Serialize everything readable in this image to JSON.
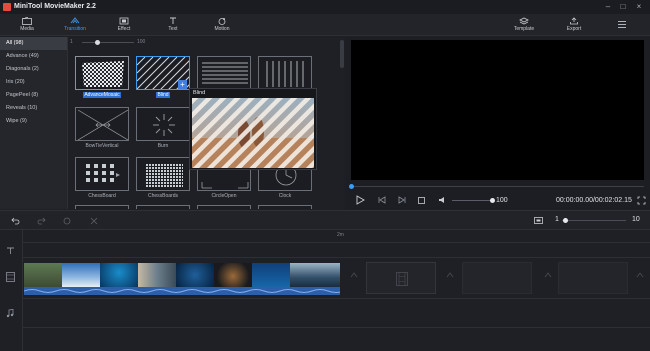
{
  "app": {
    "title": "MiniTool MovieMaker 2.2"
  },
  "toolbar": {
    "media": "Media",
    "transition": "Transition",
    "effect": "Effect",
    "text": "Text",
    "motion": "Motion",
    "template": "Template",
    "export": "Export"
  },
  "categories": [
    {
      "label": "All (98)"
    },
    {
      "label": "Advance (49)"
    },
    {
      "label": "Diagonals (2)"
    },
    {
      "label": "Iris (20)"
    },
    {
      "label": "PagePeel (8)"
    },
    {
      "label": "Reveals (10)"
    },
    {
      "label": "Wipe (9)"
    }
  ],
  "duration_slider": {
    "min_label": "1",
    "max_label": "100",
    "value": 0.3
  },
  "tiles": [
    {
      "label": "AdvanceMosaic",
      "selected": true
    },
    {
      "label": "Blind",
      "selected": true
    },
    {
      "label": ""
    },
    {
      "label": ""
    },
    {
      "label": "BowTieVertical"
    },
    {
      "label": "Burn"
    },
    {
      "label": ""
    },
    {
      "label": ""
    },
    {
      "label": "ChessBoard"
    },
    {
      "label": "ChessBoards"
    },
    {
      "label": "CircleOpen"
    },
    {
      "label": "Clock"
    }
  ],
  "preview": {
    "title": "Blind"
  },
  "player": {
    "volume": "100",
    "volume_level": 1.0,
    "time": "00:00:00.00/00:02:02.15",
    "progress": 0.0
  },
  "timeline": {
    "ruler_mark": "2m",
    "zoom_min": "1",
    "zoom_max": "10",
    "zoom_level": 0.05
  },
  "colors": {
    "accent": "#3e9cf0",
    "audio_wave": "#3a6fb8",
    "selection": "#2e6fd1"
  }
}
